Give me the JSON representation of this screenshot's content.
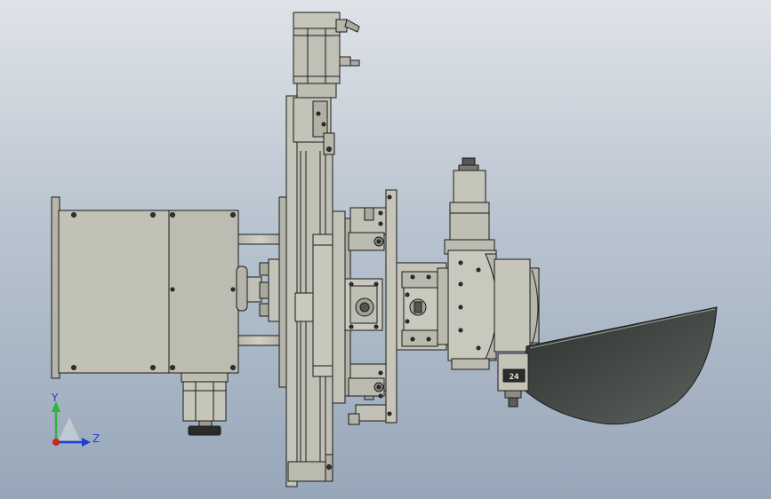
{
  "scene": {
    "background_top": "#dfe3e8",
    "background_bottom": "#97a7b9",
    "part_fill": "#c4c3b8",
    "part_stroke": "#1a1a1a",
    "shadow_fill": "#3f4240"
  },
  "labels": {
    "module_plate": "24"
  },
  "triad": {
    "y_label": "Y",
    "z_label": "Z",
    "y_color": "#2fb33a",
    "z_color": "#1f3fd0",
    "x_color": "#d02020"
  }
}
